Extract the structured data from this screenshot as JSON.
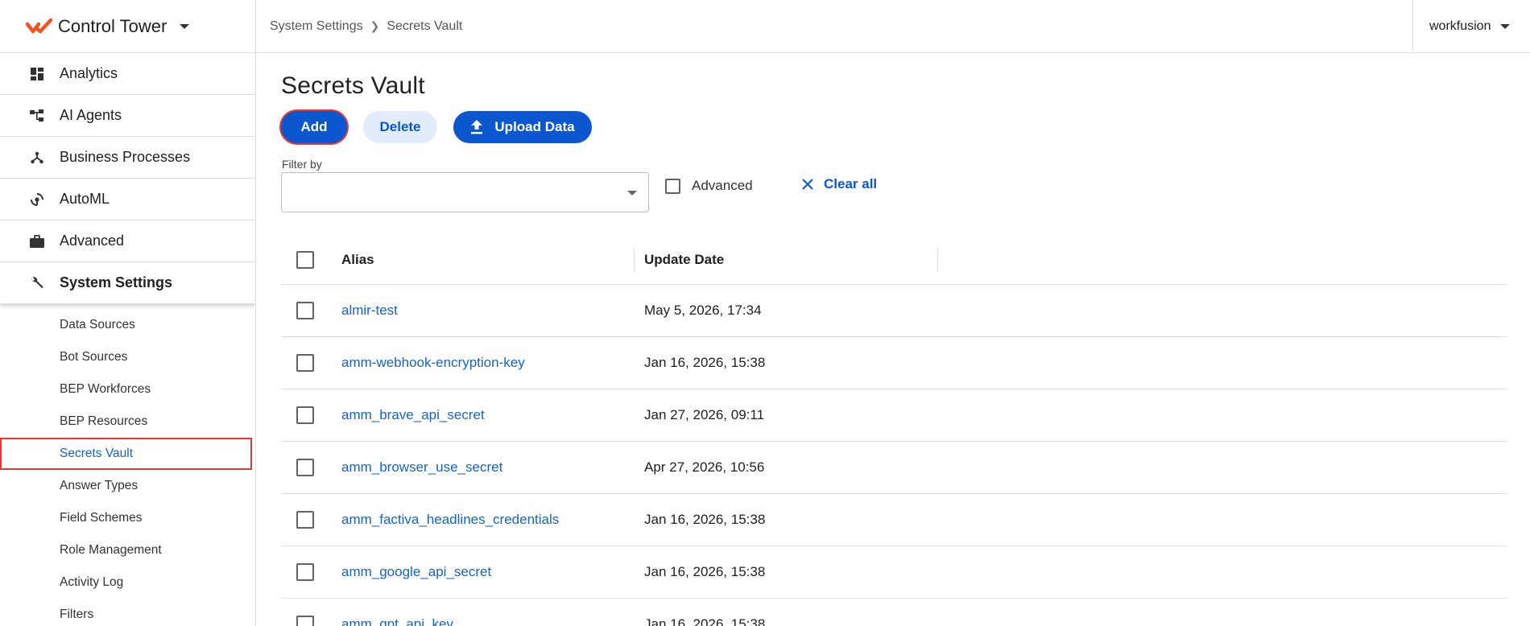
{
  "app": {
    "name": "Control Tower",
    "brand_color": "#f4511e",
    "accent_color": "#0b57d0"
  },
  "sidebar": {
    "items": [
      {
        "label": "Analytics",
        "icon": "dashboard-icon"
      },
      {
        "label": "AI Agents",
        "icon": "hierarchy-icon"
      },
      {
        "label": "Business Processes",
        "icon": "process-fork-icon"
      },
      {
        "label": "AutoML",
        "icon": "automl-icon"
      },
      {
        "label": "Advanced",
        "icon": "briefcase-icon"
      },
      {
        "label": "System Settings",
        "icon": "wrench-icon"
      }
    ],
    "sub_items": [
      "Data Sources",
      "Bot Sources",
      "BEP Workforces",
      "BEP Resources",
      "Secrets Vault",
      "Answer Types",
      "Field Schemes",
      "Role Management",
      "Activity Log",
      "Filters"
    ]
  },
  "topbar": {
    "breadcrumb": [
      "System Settings",
      "Secrets Vault"
    ],
    "user": "workfusion"
  },
  "main": {
    "title": "Secrets Vault",
    "buttons": {
      "add": "Add",
      "delete": "Delete",
      "upload": "Upload Data"
    },
    "filter": {
      "label": "Filter by",
      "value": "",
      "advanced_label": "Advanced",
      "clear_label": "Clear all"
    },
    "table": {
      "headers": {
        "alias": "Alias",
        "date": "Update Date"
      },
      "rows": [
        {
          "alias": "almir-test",
          "date": "May 5, 2026, 17:34"
        },
        {
          "alias": "amm-webhook-encryption-key",
          "date": "Jan 16, 2026, 15:38"
        },
        {
          "alias": "amm_brave_api_secret",
          "date": "Jan 27, 2026, 09:11"
        },
        {
          "alias": "amm_browser_use_secret",
          "date": "Apr 27, 2026, 10:56"
        },
        {
          "alias": "amm_factiva_headlines_credentials",
          "date": "Jan 16, 2026, 15:38"
        },
        {
          "alias": "amm_google_api_secret",
          "date": "Jan 16, 2026, 15:38"
        },
        {
          "alias": "amm_gpt_api_key",
          "date": "Jan 16, 2026, 15:38"
        }
      ]
    }
  }
}
